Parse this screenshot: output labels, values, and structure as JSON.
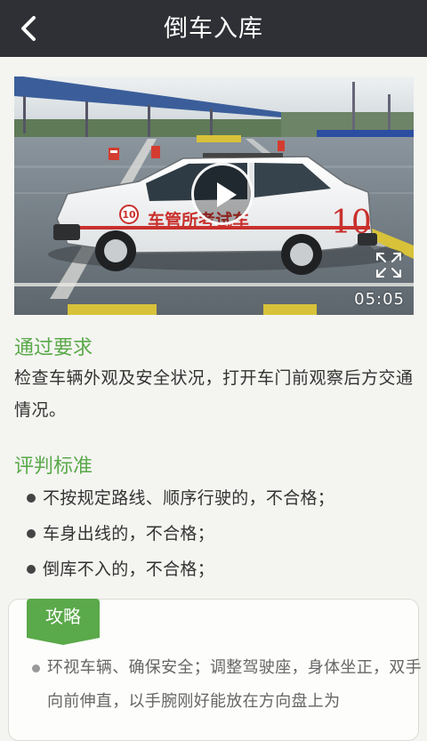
{
  "header": {
    "title": "倒车入库"
  },
  "video": {
    "duration": "05:05",
    "car_door_text": "车管所考试车",
    "car_number": "10",
    "car_badge": "10"
  },
  "requirements": {
    "title": "通过要求",
    "text": "检查车辆外观及安全状况，打开车门前观察后方交通情况。"
  },
  "criteria": {
    "title": "评判标准",
    "items": [
      "不按规定路线、顺序行驶的，不合格；",
      "车身出线的，不合格；",
      "倒库不入的，不合格；"
    ]
  },
  "tips": {
    "tab_label": "攻略",
    "text": "环视车辆、确保安全；调整驾驶座，身体坐正，双手向前伸直，以手腕刚好能放在方向盘上为"
  },
  "colors": {
    "header_bg": "#2f3035",
    "accent_green": "#5aa94a",
    "page_bg": "#f4f4f1"
  }
}
